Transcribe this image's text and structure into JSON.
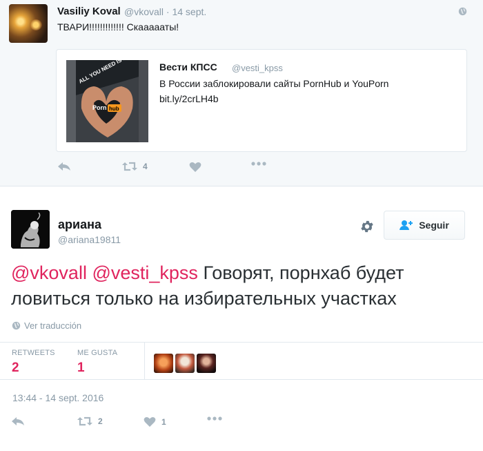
{
  "parent_tweet": {
    "author_name": "Vasiliy Koval",
    "author_handle": "@vkovall",
    "date": "· 14 sept.",
    "text": "ТВАРИ!!!!!!!!!!!!! Скаааааты!",
    "quoted": {
      "author_name": "Вести КПСС",
      "author_handle": "@vesti_kpss",
      "text": "В России заблокировали сайты PornHub и YouPorn",
      "link": "bit.ly/2crLH4b",
      "image_caption": "ALL YOU NEED IS HAND",
      "image_logo_left": "Porn",
      "image_logo_right": "hub"
    },
    "actions": {
      "retweet_count": "4"
    }
  },
  "main_tweet": {
    "author_name": "ариана",
    "author_handle": "@ariana19811",
    "follow_label": "Seguir",
    "mention1": "@vkovall",
    "mention2": "@vesti_kpss",
    "text": " Говорят, порнхаб будет ловиться только на избирательных участках",
    "translate_label": "Ver traducción",
    "stats": {
      "retweets_label": "RETWEETS",
      "retweets_value": "2",
      "likes_label": "ME GUSTA",
      "likes_value": "1"
    },
    "timestamp": "13:44 - 14 sept. 2016",
    "actions": {
      "retweet_count": "2",
      "like_count": "1"
    }
  },
  "colors": {
    "accent": "#e0245e",
    "muted": "#8899a6",
    "icon": "#aab8c2"
  },
  "icons": [
    "globe-icon",
    "reply-icon",
    "retweet-icon",
    "heart-icon",
    "more-icon",
    "gear-icon",
    "add-user-icon"
  ]
}
